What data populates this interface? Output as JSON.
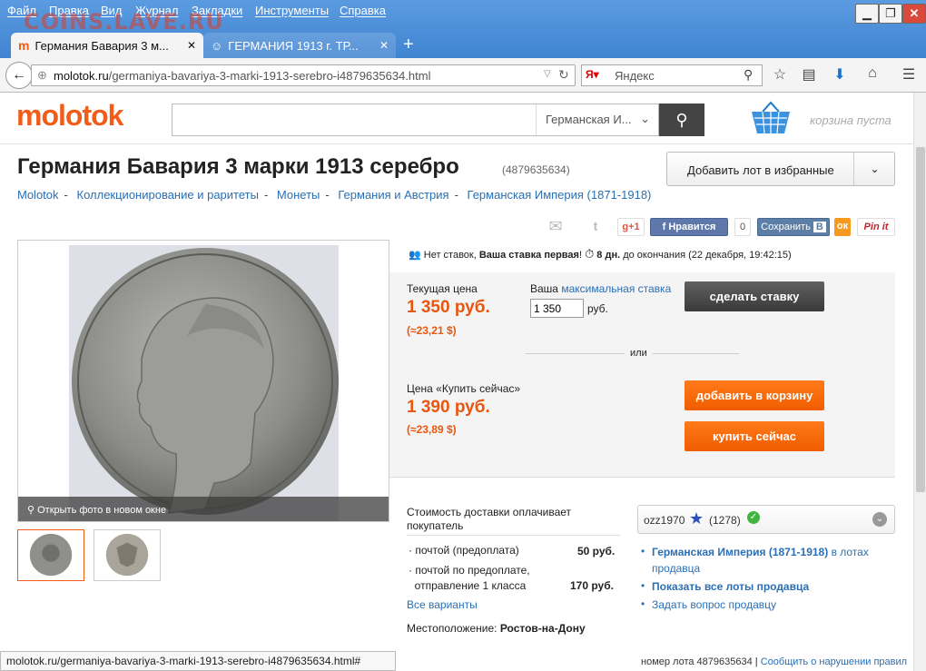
{
  "browser": {
    "menu": [
      "Файл",
      "Правка",
      "Вид",
      "Журнал",
      "Закладки",
      "Инструменты",
      "Справка"
    ],
    "watermark": "COINS.LAVE.RU",
    "tabs": [
      {
        "title": "Германия Бавария 3 м...",
        "active": true
      },
      {
        "title": "ГЕРМАНИЯ 1913 г. ТР...",
        "active": false
      }
    ],
    "url_domain": "molotok.ru",
    "url_path": "/germaniya-bavariya-3-marki-1913-serebro-i4879635634.html",
    "search_placeholder": "Яндекс",
    "status_url": "molotok.ru/germaniya-bavariya-3-marki-1913-serebro-i4879635634.html#"
  },
  "site": {
    "logo": "molotok",
    "category": "Германская И...",
    "cart_text": "корзина пуста"
  },
  "lot": {
    "title": "Германия Бавария 3 марки 1913 серебро",
    "number": "(4879635634)",
    "fav_label": "Добавить лот в избранные",
    "breadcrumb": [
      "Molotok",
      "Коллекционирование и раритеты",
      "Монеты",
      "Германия и Австрия",
      "Германская Империя (1871-1918)"
    ],
    "open_photo": "Открыть фото в новом окне"
  },
  "social": {
    "gplus": "+1",
    "fb_like": "Нравится",
    "fb_count": "0",
    "vk_save": "Сохранить",
    "pinterest": "Pin it"
  },
  "bidding": {
    "no_bids": "Нет ставок,",
    "first_bid": "Ваша ставка первая",
    "exclaim": "!",
    "days": "8 дн.",
    "until": "до окончания (22 декабря, 19:42:15)",
    "current_label": "Текущая цена",
    "current_price": "1 350 руб.",
    "current_usd": "(≈23,21 $)",
    "your_label": "Ваша",
    "max_bid_link": "максимальная ставка",
    "bid_value": "1 350",
    "rub": "руб.",
    "bid_button": "сделать ставку",
    "or": "или",
    "buy_now_label": "Цена «Купить сейчас»",
    "buy_now_price": "1 390 руб.",
    "buy_now_usd": "(≈23,89 $)",
    "add_to_cart": "добавить в корзину",
    "buy_now": "купить сейчас"
  },
  "shipping": {
    "title": "Стоимость доставки оплачивает покупатель",
    "options": [
      {
        "line1": "почтой (предоплата)",
        "line2": "",
        "price": "50 руб."
      },
      {
        "line1": "почтой по предоплате,",
        "line2": "отправление 1 класса",
        "price": "170 руб."
      }
    ],
    "all_variants": "Все варианты",
    "location_label": "Местоположение:",
    "location": "Ростов-на-Дону"
  },
  "seller": {
    "name": "ozz1970",
    "rating": "(1278)",
    "link1_bold": "Германская Империя (1871-1918)",
    "link1_rest": "в лотах продавца",
    "link2": "Показать все лоты продавца",
    "link3": "Задать вопрос продавцу"
  },
  "footer": {
    "lot_number": "номер лота 4879635634",
    "report": "Сообщить о нарушении правил"
  },
  "colors": {
    "accent": "#f25c19",
    "link": "#2a6fb5",
    "price": "#e8560f"
  }
}
